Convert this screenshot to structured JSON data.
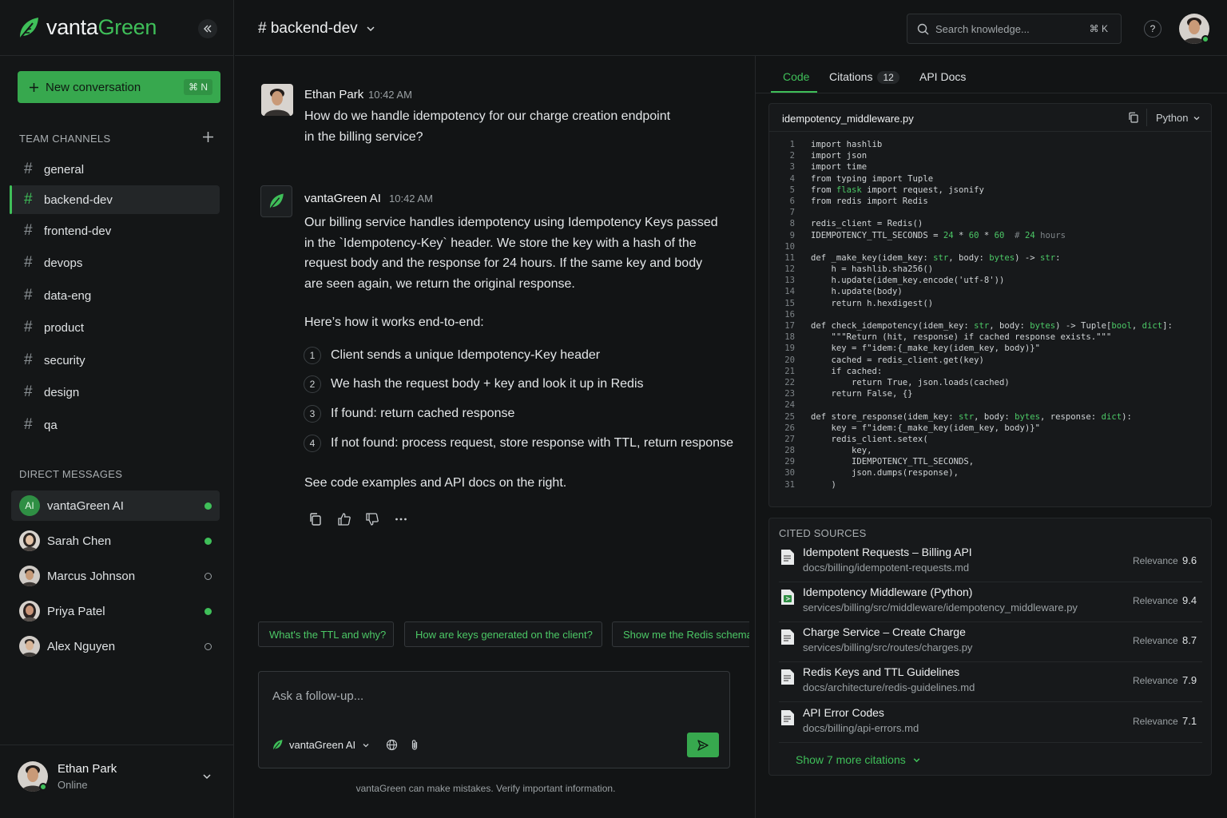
{
  "app": {
    "brand_a": "vanta",
    "brand_b": "Green"
  },
  "sidebar": {
    "new_conversation": "New conversation",
    "new_conversation_shortcut": "⌘ N",
    "team_channels_title": "TEAM CHANNELS",
    "channels": [
      "general",
      "backend-dev",
      "frontend-dev",
      "devops",
      "data-eng",
      "product",
      "security",
      "design",
      "qa"
    ],
    "direct_messages_title": "DIRECT MESSAGES",
    "dms": [
      {
        "name": "vantaGreen AI",
        "avatar": "AI",
        "online": true
      },
      {
        "name": "Sarah Chen",
        "online": true
      },
      {
        "name": "Marcus Johnson",
        "online": false
      },
      {
        "name": "Priya Patel",
        "online": true
      },
      {
        "name": "Alex Nguyen",
        "online": false
      }
    ],
    "user": {
      "name": "Ethan Park",
      "status": "Online"
    }
  },
  "header": {
    "channel": "# backend-dev",
    "search_placeholder": "Search knowledge...",
    "search_shortcut": "⌘ K",
    "help": "?"
  },
  "chat": {
    "user_message": {
      "author": "Ethan Park",
      "time": "10:42 AM",
      "lines": [
        "How do we handle idempotency for our charge creation endpoint",
        "in the billing service?"
      ]
    },
    "ai_message": {
      "author": "vantaGreen AI",
      "time": "10:42 AM",
      "para_lines": [
        "Our billing service handles idempotency using Idempotency Keys passed",
        "in the `Idempotency-Key` header. We store the key with a hash of the",
        "request body and the response for 24 hours. If the same key and body",
        "are seen again, we return the original response."
      ],
      "intro": "Here’s how it works end-to-end:",
      "steps": [
        {
          "n": "1",
          "text": "Client sends a unique Idempotency-Key header"
        },
        {
          "n": "2",
          "text": "We hash the request body + key and look it up in Redis"
        },
        {
          "n": "3",
          "text": "If found: return cached response"
        },
        {
          "n": "4",
          "text": "If not found: process request, store response with TTL, return response"
        }
      ],
      "outro": "See code examples and API docs on the right."
    },
    "suggestions": [
      "What's the TTL and why?",
      "How are keys generated on the client?",
      "Show me the Redis schema"
    ],
    "composer": {
      "placeholder": "Ask a follow-up...",
      "model": "vantaGreen AI"
    },
    "disclaimer": "vantaGreen can make mistakes. Verify important information."
  },
  "panel": {
    "tabs": {
      "code": "Code",
      "citations": "Citations",
      "citations_count": "12",
      "api_docs": "API Docs"
    },
    "code_file": "idempotency_middleware.py",
    "language": "Python",
    "code_lines": [
      "import hashlib",
      "import json",
      "import time",
      "from typing import Tuple",
      "from flask import request, jsonify",
      "from redis import Redis",
      "",
      "redis_client = Redis()",
      "IDEMPOTENCY_TTL_SECONDS = 24 * 60 * 60  # 24 hours",
      "",
      "def _make_key(idem_key: str, body: bytes) -> str:",
      "    h = hashlib.sha256()",
      "    h.update(idem_key.encode('utf-8'))",
      "    h.update(body)",
      "    return h.hexdigest()",
      "",
      "def check_idempotency(idem_key: str, body: bytes) -> Tuple[bool, dict]:",
      "    \"\"\"Return (hit, response) if cached response exists.\"\"\"",
      "    key = f\"idem:{_make_key(idem_key, body)}\"",
      "    cached = redis_client.get(key)",
      "    if cached:",
      "        return True, json.loads(cached)",
      "    return False, {}",
      "",
      "def store_response(idem_key: str, body: bytes, response: dict):",
      "    key = f\"idem:{_make_key(idem_key, body)}\"",
      "    redis_client.setex(",
      "        key,",
      "        IDEMPOTENCY_TTL_SECONDS,",
      "        json.dumps(response),",
      "    )"
    ],
    "sources_title": "CITED SOURCES",
    "relevance_label": "Relevance",
    "sources": [
      {
        "title": "Idempotent Requests – Billing API",
        "path": "docs/billing/idempotent-requests.md",
        "relevance": "9.6"
      },
      {
        "title": "Idempotency Middleware (Python)",
        "path": "services/billing/src/middleware/idempotency_middleware.py",
        "relevance": "9.4"
      },
      {
        "title": "Charge Service – Create Charge",
        "path": "services/billing/src/routes/charges.py",
        "relevance": "8.7"
      },
      {
        "title": "Redis Keys and TTL Guidelines",
        "path": "docs/architecture/redis-guidelines.md",
        "relevance": "7.9"
      },
      {
        "title": "API Error Codes",
        "path": "docs/billing/api-errors.md",
        "relevance": "7.1"
      }
    ],
    "show_more": "Show 7 more citations"
  },
  "colors": {
    "accent": "#3fbf59",
    "button": "#37a84e",
    "bg": "#121415"
  }
}
